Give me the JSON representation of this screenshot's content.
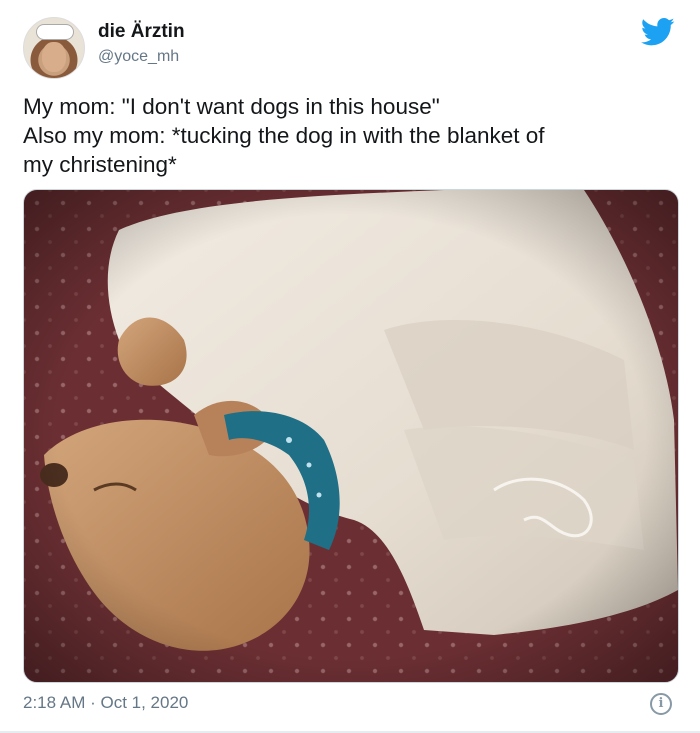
{
  "tweet": {
    "author": {
      "display_name": "die Ärztin",
      "handle": "@yoce_mh",
      "avatar_icon": "profile-avatar"
    },
    "text_lines": [
      "My mom: \"I don't want dogs in this house\"",
      "Also my mom: *tucking the dog in with the blanket of",
      "my christening*"
    ],
    "media": {
      "description_icon": "photo-dog-under-blanket"
    },
    "timestamp": "2:18 AM · Oct 1, 2020",
    "brand_icon": "twitter-bird-icon",
    "info_icon_glyph": "i"
  },
  "colors": {
    "twitter_blue": "#1DA1F2",
    "secondary_text": "#657786",
    "primary_text": "#14171a",
    "bedspread": "#6b2f33",
    "blanket": "#ece4d9",
    "dog_fur": "#c08a5e",
    "collar": "#1f6f86"
  }
}
